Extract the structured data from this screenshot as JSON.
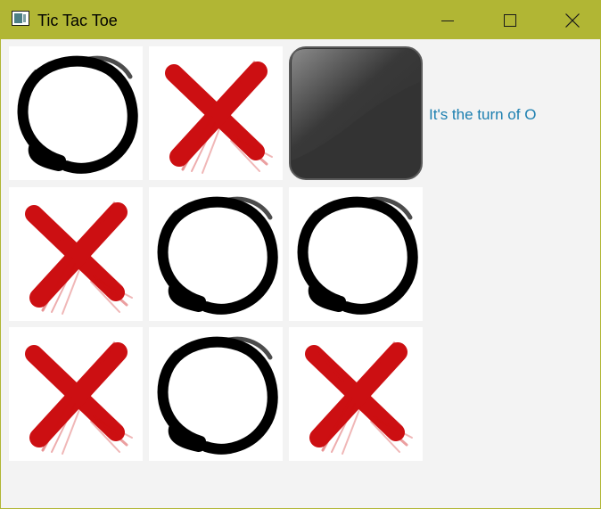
{
  "window": {
    "title": "Tic Tac Toe",
    "title_bar_color": "#b1b634",
    "controls": [
      "minimize-icon",
      "maximize-icon",
      "close-icon"
    ]
  },
  "board": {
    "cells": [
      {
        "row": 1,
        "col": 1,
        "mark": "O"
      },
      {
        "row": 1,
        "col": 2,
        "mark": "X"
      },
      {
        "row": 1,
        "col": 3,
        "mark": "",
        "state": "empty-dark-button"
      },
      {
        "row": 2,
        "col": 1,
        "mark": "X"
      },
      {
        "row": 2,
        "col": 2,
        "mark": "O"
      },
      {
        "row": 2,
        "col": 3,
        "mark": "O"
      },
      {
        "row": 3,
        "col": 1,
        "mark": "X"
      },
      {
        "row": 3,
        "col": 2,
        "mark": "O"
      },
      {
        "row": 3,
        "col": 3,
        "mark": "X"
      }
    ],
    "x_color": "#cc0f12",
    "o_color": "#000000"
  },
  "status": {
    "text": "It's the turn of O",
    "color": "#1c7fb0"
  }
}
